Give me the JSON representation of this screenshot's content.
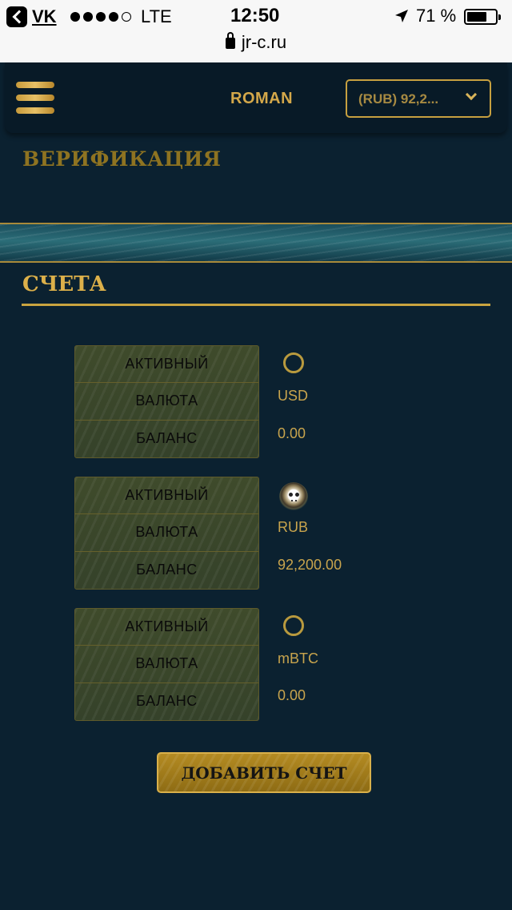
{
  "status_bar": {
    "back_app": "VK",
    "network": "LTE",
    "time": "12:50",
    "battery_percent": "71 %",
    "battery_level": 0.71,
    "signal_bars_filled": 4,
    "url": "jr-c.ru"
  },
  "header": {
    "username": "ROMAN",
    "balance_selector": "(RUB) 92,2..."
  },
  "verification_heading": "ВЕРИФИКАЦИЯ",
  "accounts_heading": "СЧЕТА",
  "account_labels": {
    "active": "АКТИВНЫЙ",
    "currency": "ВАЛЮТА",
    "balance": "БАЛАНС"
  },
  "accounts": [
    {
      "active": false,
      "currency": "USD",
      "balance": "0.00"
    },
    {
      "active": true,
      "currency": "RUB",
      "balance": "92,200.00"
    },
    {
      "active": false,
      "currency": "mBTC",
      "balance": "0.00"
    }
  ],
  "add_account_button": "ДОБАВИТЬ СЧЕТ",
  "colors": {
    "background": "#0b2130",
    "gold": "#dcb04a"
  }
}
